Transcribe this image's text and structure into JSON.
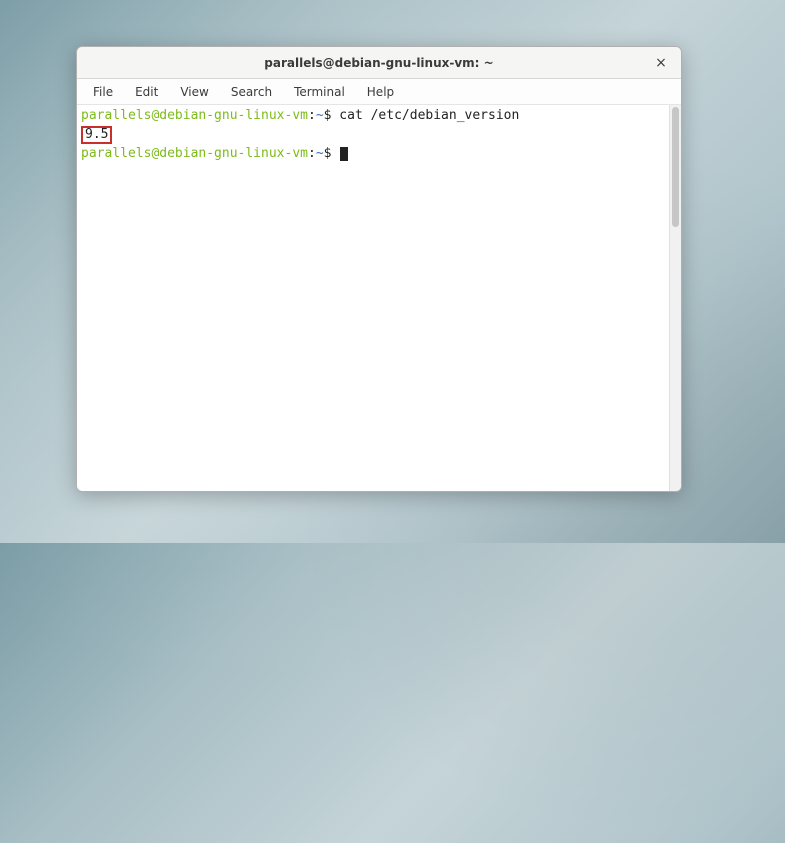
{
  "window": {
    "title": "parallels@debian-gnu-linux-vm: ~",
    "close_label": "×"
  },
  "menubar": {
    "items": [
      "File",
      "Edit",
      "View",
      "Search",
      "Terminal",
      "Help"
    ]
  },
  "terminal": {
    "prompt_user_host": "parallels@debian-gnu-linux-vm",
    "prompt_sep": ":",
    "prompt_path": "~",
    "prompt_symbol": "$",
    "command": "cat /etc/debian_version",
    "output": "9.5"
  },
  "colors": {
    "prompt_green": "#7dbb1a",
    "path_blue": "#3a6cc9",
    "highlight_red": "#c9302c"
  }
}
